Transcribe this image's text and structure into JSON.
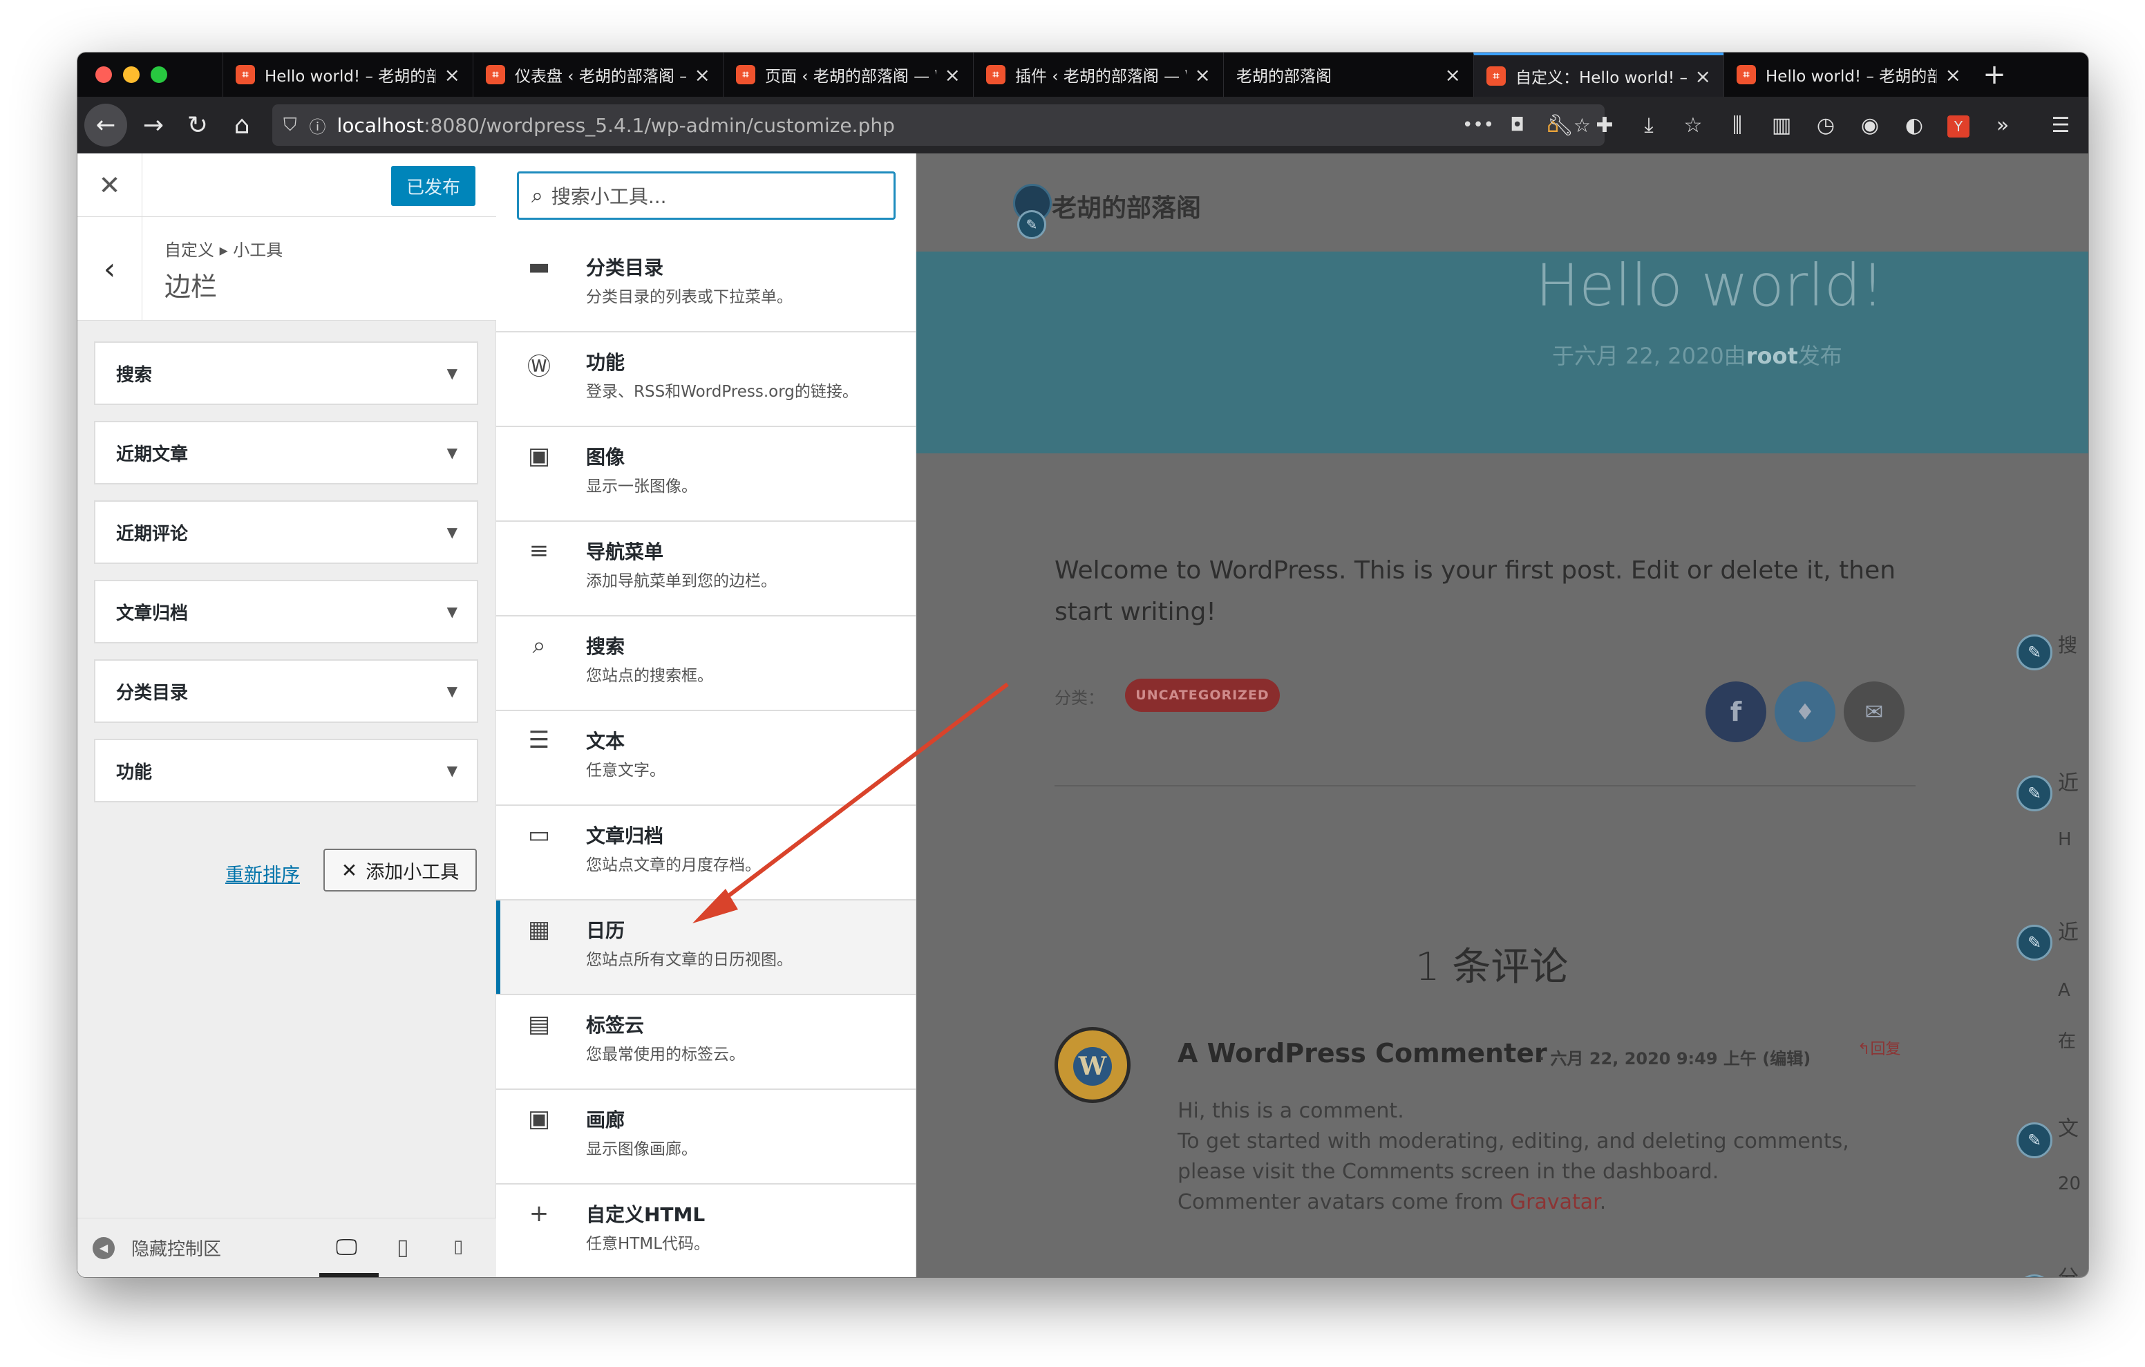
{
  "browser": {
    "tabs": [
      {
        "title": "Hello world! – 老胡的部",
        "active": false
      },
      {
        "title": "仪表盘 ‹ 老胡的部落阁 –",
        "active": false
      },
      {
        "title": "页面 ‹ 老胡的部落阁 — W",
        "active": false
      },
      {
        "title": "插件 ‹ 老胡的部落阁 — W",
        "active": false
      },
      {
        "title": "老胡的部落阁",
        "active": false
      },
      {
        "title": "自定义：Hello world! –",
        "active": true
      },
      {
        "title": "Hello world! – 老胡的部",
        "active": false
      }
    ],
    "url_host": "localhost",
    "url_rest": ":8080/wordpress_5.4.1/wp-admin/customize.php",
    "accent": "#3aa0ff"
  },
  "customizer": {
    "publish_label": "已发布",
    "breadcrumb": "自定义 ▸ 小工具",
    "section_title": "边栏",
    "widgets": [
      "搜索",
      "近期文章",
      "近期评论",
      "文章归档",
      "分类目录",
      "功能"
    ],
    "reorder_label": "重新排序",
    "add_widget_label": "添加小工具",
    "hide_controls_label": "隐藏控制区"
  },
  "available_widgets": {
    "search_placeholder": "搜索小工具...",
    "items": [
      {
        "name": "分类目录",
        "desc": "分类目录的列表或下拉菜单。",
        "icon": "folder-icon"
      },
      {
        "name": "功能",
        "desc": "登录、RSS和WordPress.org的链接。",
        "icon": "wordpress-icon"
      },
      {
        "name": "图像",
        "desc": "显示一张图像。",
        "icon": "image-icon"
      },
      {
        "name": "导航菜单",
        "desc": "添加导航菜单到您的边栏。",
        "icon": "menu-icon"
      },
      {
        "name": "搜索",
        "desc": "您站点的搜索框。",
        "icon": "search-icon"
      },
      {
        "name": "文本",
        "desc": "任意文字。",
        "icon": "text-icon"
      },
      {
        "name": "文章归档",
        "desc": "您站点文章的月度存档。",
        "icon": "archive-icon"
      },
      {
        "name": "日历",
        "desc": "您站点所有文章的日历视图。",
        "icon": "calendar-icon",
        "selected": true
      },
      {
        "name": "标签云",
        "desc": "您最常使用的标签云。",
        "icon": "tag-cloud-icon"
      },
      {
        "name": "画廊",
        "desc": "显示图像画廊。",
        "icon": "gallery-icon"
      },
      {
        "name": "自定义HTML",
        "desc": "任意HTML代码。",
        "icon": "plus-icon"
      }
    ]
  },
  "preview": {
    "site_name": "老胡的部落阁",
    "post_title": "Hello world!",
    "post_meta_prefix": "于六月 22, 2020由",
    "post_author": "root",
    "post_meta_suffix": "发布",
    "post_body": "Welcome to WordPress. This is your first post. Edit or delete it, then start writing!",
    "category_label": "分类：",
    "category_badge": "UNCATEGORIZED",
    "comments_title": "1 条评论",
    "commenter": "A WordPress Commenter",
    "comment_meta": "· 六月 22, 2020 9:49 上午 (编辑)",
    "reply_label": "回复",
    "comment_lines": [
      "Hi, this is a comment.",
      "To get started with moderating, editing, and deleting comments, please visit the Comments screen in the dashboard."
    ],
    "avatar_line_prefix": "Commenter avatars come from ",
    "avatar_link": "Gravatar",
    "avatar_line_suffix": ".",
    "sidebar_fragments": [
      "搜",
      "近",
      "H",
      "近",
      "A",
      "在",
      "文",
      "20",
      "分"
    ]
  }
}
